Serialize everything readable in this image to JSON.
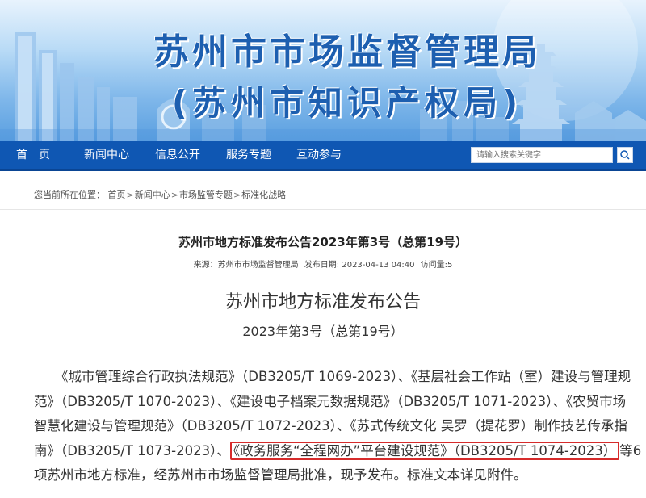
{
  "banner": {
    "title_main": "苏州市市场监督管理局",
    "title_sub": "(苏州市知识产权局)"
  },
  "nav": {
    "items": [
      "首　页",
      "新闻中心",
      "信息公开",
      "服务专题",
      "互动参与"
    ],
    "search_placeholder": "请输入搜索关键字"
  },
  "breadcrumb": {
    "label": "您当前所在位置：",
    "items": [
      "首页",
      "新闻中心",
      "市场监管专题",
      "标准化战略"
    ],
    "separator": ">"
  },
  "article": {
    "title": "苏州市地方标准发布公告2023年第3号（总第19号）",
    "source": "来源：苏州市市场监督管理局",
    "published": "发布日期: 2023-04-13 04:40",
    "views": "访问量:5",
    "doc_heading": "苏州市地方标准发布公告",
    "doc_number": "2023年第3号（总第19号）",
    "body": {
      "line1": "《城市管理综合行政执法规范》（DB3205/T 1069-2023）、《基层社会工作站（室）建设与管理规",
      "line2": "范》（DB3205/T 1070-2023）、《建设电子档案元数据规范》（DB3205/T 1071-2023）、《农贸市场",
      "line3": "智慧化建设与管理规范》（DB3205/T 1072-2023）、《苏式传统文化 吴罗（提花罗）制作技艺传承指",
      "line4_pre": "南》（DB3205/T 1073-2023）、",
      "line4_highlight": "《政务服务“全程网办”平台建设规范》（DB3205/T 1074-2023）",
      "line4_post": "等6",
      "line5": "项苏州市地方标准，经苏州市市场监督管理局批准，现予发布。标准文本详见附件。"
    }
  },
  "colors": {
    "nav_bg": "#0f57b3",
    "title_blue": "#1d5fb0",
    "highlight_border": "#d62b2b"
  }
}
